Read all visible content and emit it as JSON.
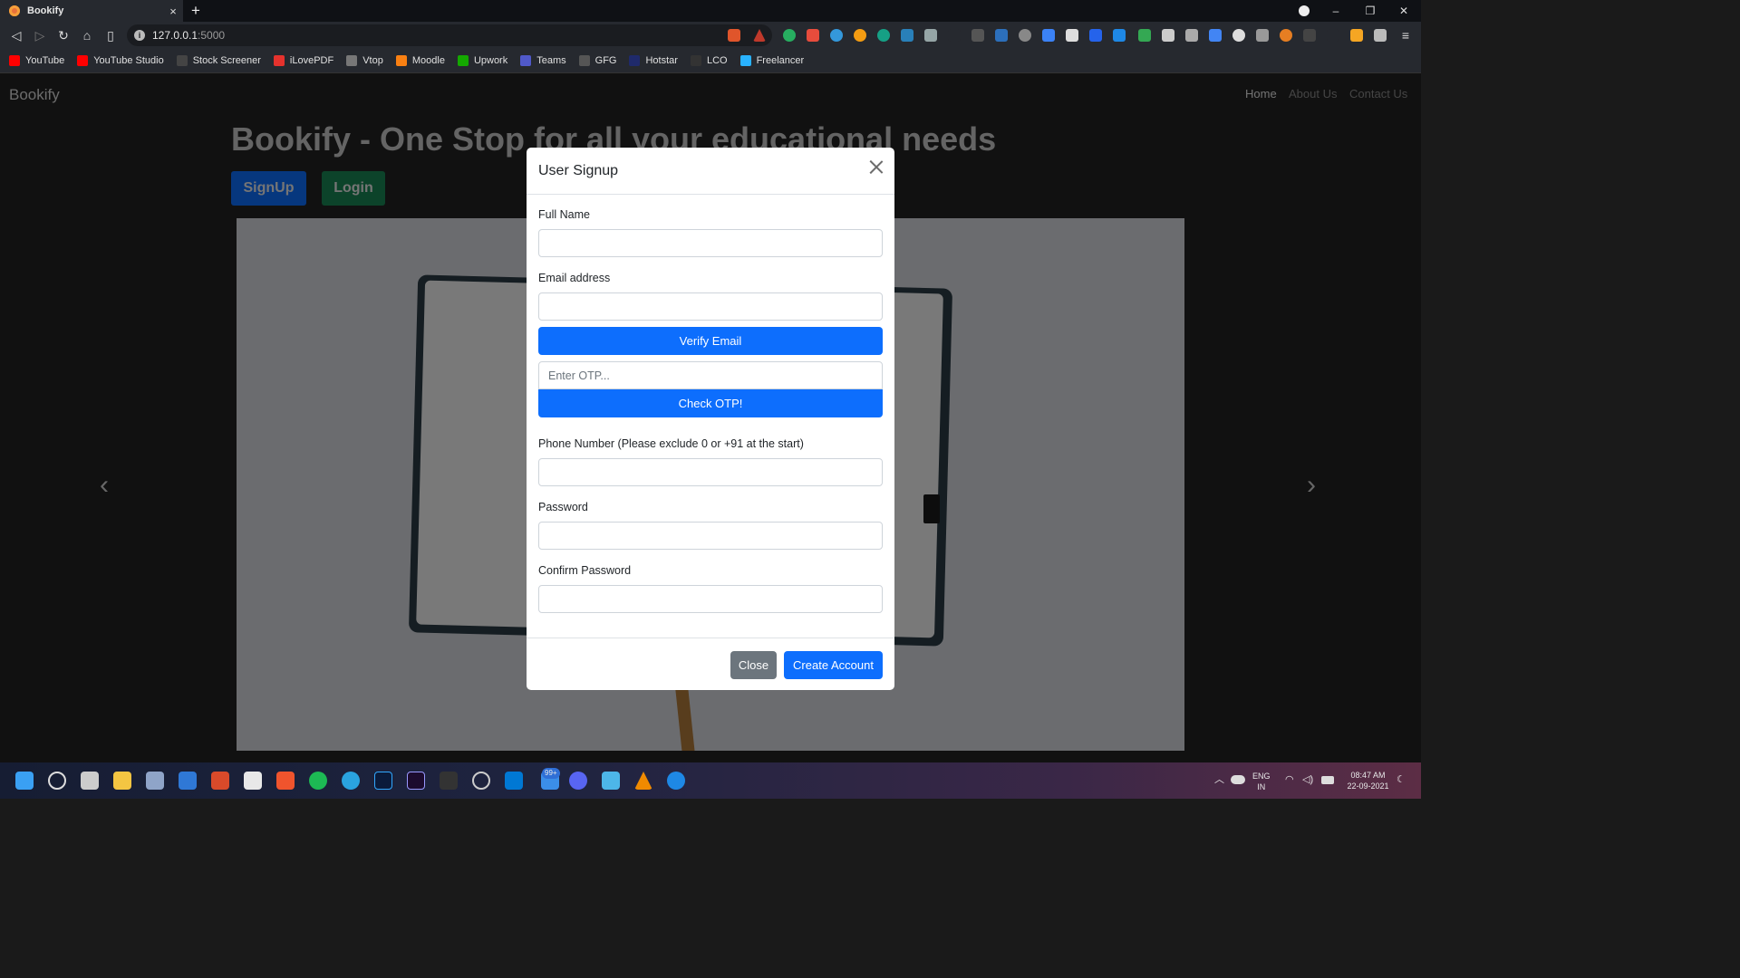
{
  "browser": {
    "tab_title": "Bookify",
    "tab_close": "×",
    "new_tab": "+",
    "url_host": "127.0.0.1",
    "url_port": ":5000",
    "win_minimize": "–",
    "win_restore": "❐",
    "win_close": "✕"
  },
  "bookmarks": [
    {
      "label": "YouTube",
      "color": "#ff0000"
    },
    {
      "label": "YouTube Studio",
      "color": "#ff0000"
    },
    {
      "label": "Stock Screener",
      "color": "#444444"
    },
    {
      "label": "iLovePDF",
      "color": "#e5322d"
    },
    {
      "label": "Vtop",
      "color": "#777777"
    },
    {
      "label": "Moodle",
      "color": "#f98012"
    },
    {
      "label": "Upwork",
      "color": "#14a800"
    },
    {
      "label": "Teams",
      "color": "#5059c9"
    },
    {
      "label": "GFG",
      "color": "#555555"
    },
    {
      "label": "Hotstar",
      "color": "#1f2a6b"
    },
    {
      "label": "LCO",
      "color": "#333333"
    },
    {
      "label": "Freelancer",
      "color": "#29b2fe"
    }
  ],
  "site": {
    "brand": "Bookify",
    "nav": [
      "Home",
      "About Us",
      "Contact Us"
    ],
    "hero_title": "Bookify - One Stop for all your educational needs",
    "signup_label": "SignUp",
    "login_label": "Login",
    "prev_arrow": "‹",
    "next_arrow": "›"
  },
  "modal": {
    "title": "User Signup",
    "full_name_label": "Full Name",
    "email_label": "Email address",
    "verify_email_label": "Verify Email",
    "otp_placeholder": "Enter OTP...",
    "check_otp_label": "Check OTP!",
    "phone_label": "Phone Number (Please exclude 0 or +91 at the start)",
    "password_label": "Password",
    "confirm_password_label": "Confirm Password",
    "close_label": "Close",
    "create_account_label": "Create Account"
  },
  "taskbar": {
    "lang_top": "ENG",
    "lang_bottom": "IN",
    "time": "08:47 AM",
    "date": "22-09-2021",
    "badge": "99+"
  },
  "colors": {
    "primary": "#0d6efd",
    "secondary": "#6c757d"
  }
}
